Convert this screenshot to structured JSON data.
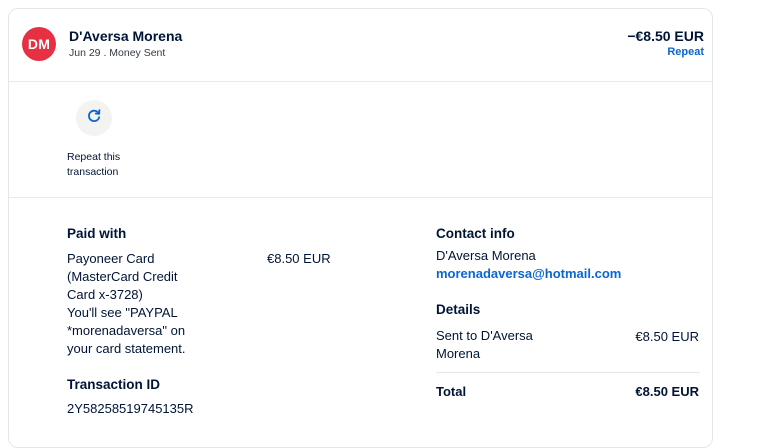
{
  "header": {
    "avatar_initials": "DM",
    "name": "D'Aversa Morena",
    "subline": "Jun 29 . Money Sent",
    "amount": "−€8.50 EUR",
    "repeat_link": "Repeat"
  },
  "actions": {
    "repeat_label_line1": "Repeat this",
    "repeat_label_line2": "transaction",
    "repeat_icon": "refresh-icon"
  },
  "paid_with": {
    "title": "Paid with",
    "lines": [
      "Payoneer Card",
      "(MasterCard Credit",
      "Card x-3728)",
      "You'll see \"PAYPAL",
      "*morenadaversa\" on",
      "your card statement."
    ],
    "amount": "€8.50 EUR"
  },
  "transaction": {
    "title": "Transaction ID",
    "id": "2Y58258519745135R"
  },
  "contact": {
    "title": "Contact info",
    "name": "D'Aversa Morena",
    "email": "morenadaversa@hotmail.com"
  },
  "details": {
    "title": "Details",
    "sent_to_line1": "Sent to D'Aversa",
    "sent_to_line2": "Morena",
    "sent_amount": "€8.50 EUR",
    "total_label": "Total",
    "total_amount": "€8.50 EUR"
  },
  "colors": {
    "avatar_bg": "#e63143",
    "link": "#0b66d0",
    "text": "#001435"
  }
}
